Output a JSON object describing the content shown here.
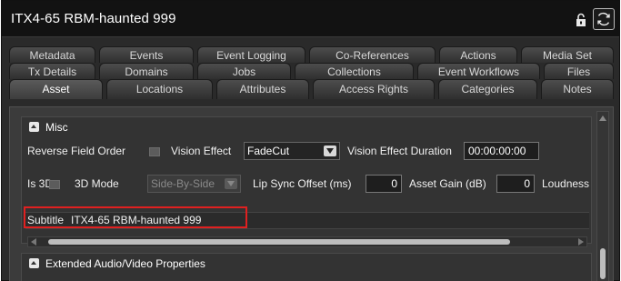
{
  "window": {
    "title": "ITX4-65 RBM-haunted 999",
    "icons": [
      "lock-icon",
      "refresh-icon"
    ]
  },
  "tabs": {
    "row1": [
      "Metadata",
      "Events",
      "Event Logging",
      "Co-References",
      "Actions",
      "Media Set"
    ],
    "row2": [
      "Tx Details",
      "Domains",
      "Jobs",
      "Collections",
      "Event Workflows",
      "Files"
    ],
    "row3": [
      "Asset",
      "Locations",
      "Attributes",
      "Access Rights",
      "Categories",
      "Notes"
    ],
    "active": "Asset"
  },
  "misc": {
    "header": "Misc",
    "reverse_field_order_label": "Reverse Field Order",
    "vision_effect_label": "Vision Effect",
    "vision_effect_value": "FadeCut",
    "vision_effect_duration_label": "Vision Effect Duration",
    "vision_effect_duration_value": "00:00:00:00",
    "is3d_label": "Is 3D",
    "mode3d_label": "3D Mode",
    "mode3d_value": "Side-By-Side",
    "lip_sync_label": "Lip Sync Offset (ms)",
    "lip_sync_value": "0",
    "asset_gain_label": "Asset Gain (dB)",
    "asset_gain_value": "0",
    "loudness_label": "Loudness",
    "subtitle_label": "Subtitle",
    "subtitle_value": "ITX4-65 RBM-haunted 999"
  },
  "extended": {
    "header": "Extended Audio/Video Properties"
  },
  "colors": {
    "highlight": "#e02020",
    "background": "#2a2a2a",
    "titlebar": "#121212"
  }
}
